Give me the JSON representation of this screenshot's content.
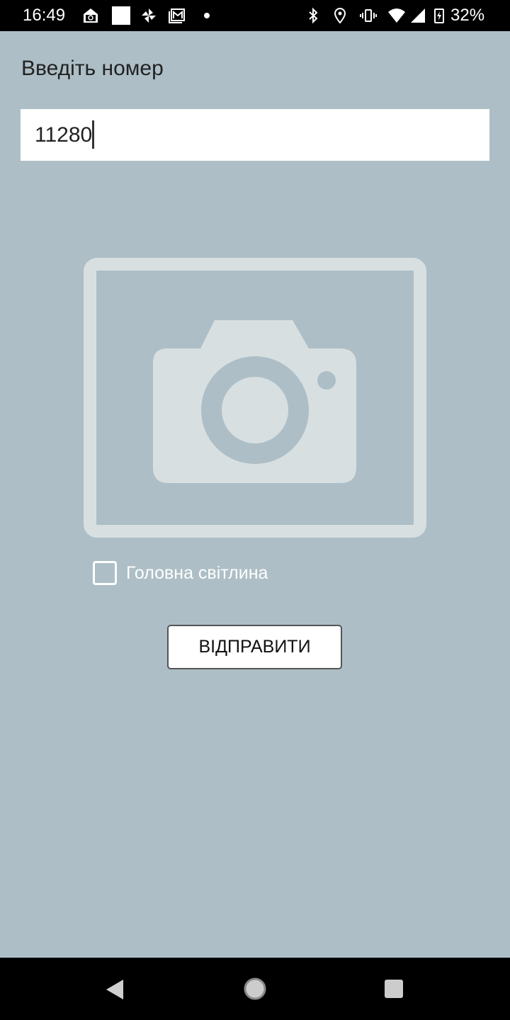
{
  "status_bar": {
    "time": "16:49",
    "battery": "32%",
    "icons": [
      "photo-app-icon",
      "square-icon",
      "pinwheel-icon",
      "gmail-icon",
      "dot-icon",
      "bluetooth-icon",
      "location-icon",
      "vibrate-icon",
      "wifi-icon",
      "signal-icon",
      "battery-charging-icon"
    ]
  },
  "form": {
    "label": "Введіть номер",
    "number_value": "11280",
    "checkbox_label": "Головна світлина",
    "checkbox_checked": false,
    "submit_label": "ВІДПРАВИТИ"
  },
  "colors": {
    "background": "#adbec6",
    "placeholder_icon": "#d7dfe1"
  },
  "nav_bar": {
    "icons": [
      "back-icon",
      "home-icon",
      "recents-icon"
    ]
  }
}
